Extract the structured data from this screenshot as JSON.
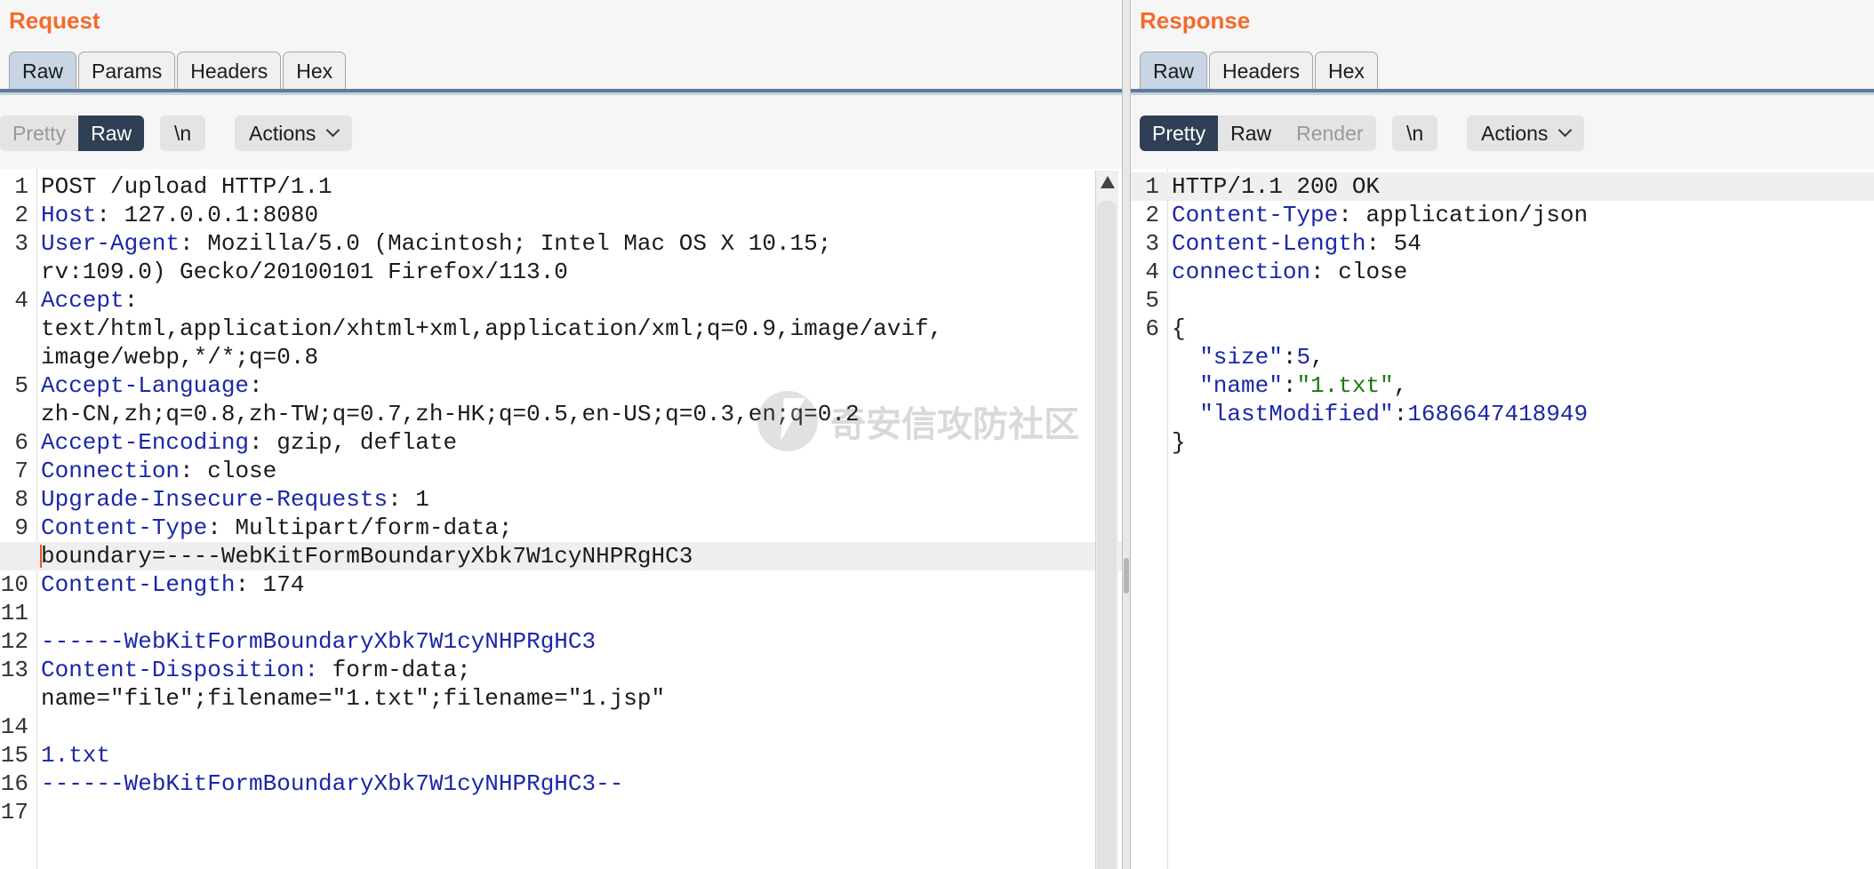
{
  "request": {
    "title": "Request",
    "tabs": [
      "Raw",
      "Params",
      "Headers",
      "Hex"
    ],
    "toolbar": {
      "pretty": "Pretty",
      "raw": "Raw",
      "newline": "\\n",
      "actions": "Actions"
    },
    "lines": [
      {
        "n": "1",
        "parts": [
          {
            "t": "POST /upload HTTP/1.1",
            "c": "plain"
          }
        ]
      },
      {
        "n": "2",
        "parts": [
          {
            "t": "Host",
            "c": "hdr"
          },
          {
            "t": ": 127.0.0.1:8080",
            "c": "plain"
          }
        ]
      },
      {
        "n": "3",
        "parts": [
          {
            "t": "User-Agent",
            "c": "hdr"
          },
          {
            "t": ": Mozilla/5.0 (Macintosh; Intel Mac OS X 10.15;",
            "c": "plain"
          }
        ]
      },
      {
        "n": "",
        "parts": [
          {
            "t": "rv:109.0) Gecko/20100101 Firefox/113.0",
            "c": "plain"
          }
        ]
      },
      {
        "n": "4",
        "parts": [
          {
            "t": "Accept",
            "c": "hdr"
          },
          {
            "t": ":",
            "c": "plain"
          }
        ]
      },
      {
        "n": "",
        "parts": [
          {
            "t": "text/html,application/xhtml+xml,application/xml;q=0.9,image/avif,",
            "c": "plain"
          }
        ]
      },
      {
        "n": "",
        "parts": [
          {
            "t": "image/webp,*/*;q=0.8",
            "c": "plain"
          }
        ]
      },
      {
        "n": "5",
        "parts": [
          {
            "t": "Accept-Language",
            "c": "hdr"
          },
          {
            "t": ":",
            "c": "plain"
          }
        ]
      },
      {
        "n": "",
        "parts": [
          {
            "t": "zh-CN,zh;q=0.8,zh-TW;q=0.7,zh-HK;q=0.5,en-US;q=0.3,en;q=0.2",
            "c": "plain"
          }
        ]
      },
      {
        "n": "6",
        "parts": [
          {
            "t": "Accept-Encoding",
            "c": "hdr"
          },
          {
            "t": ": gzip, deflate",
            "c": "plain"
          }
        ]
      },
      {
        "n": "7",
        "parts": [
          {
            "t": "Connection",
            "c": "hdr"
          },
          {
            "t": ": close",
            "c": "plain"
          }
        ]
      },
      {
        "n": "8",
        "parts": [
          {
            "t": "Upgrade-Insecure-Requests",
            "c": "hdr"
          },
          {
            "t": ": 1",
            "c": "plain"
          }
        ]
      },
      {
        "n": "9",
        "parts": [
          {
            "t": "Content-Type",
            "c": "hdr"
          },
          {
            "t": ": Multipart/form-data;",
            "c": "plain"
          }
        ]
      },
      {
        "n": "",
        "hl": true,
        "caret": true,
        "parts": [
          {
            "t": "boundary=----WebKitFormBoundaryXbk7W1cyNHPRgHC3",
            "c": "plain"
          }
        ]
      },
      {
        "n": "10",
        "parts": [
          {
            "t": "Content-Length",
            "c": "hdr"
          },
          {
            "t": ": 174",
            "c": "plain"
          }
        ]
      },
      {
        "n": "11",
        "parts": []
      },
      {
        "n": "12",
        "parts": [
          {
            "t": "------WebKitFormBoundaryXbk7W1cyNHPRgHC3",
            "c": "blue"
          }
        ]
      },
      {
        "n": "13",
        "parts": [
          {
            "t": "Content-Disposition:",
            "c": "blue"
          },
          {
            "t": " form-data;",
            "c": "plain"
          }
        ]
      },
      {
        "n": "",
        "parts": [
          {
            "t": "name=\"file\";filename=\"1.txt\";filename=\"1.jsp\"",
            "c": "plain"
          }
        ]
      },
      {
        "n": "14",
        "parts": []
      },
      {
        "n": "15",
        "parts": [
          {
            "t": "1.txt",
            "c": "blue"
          }
        ]
      },
      {
        "n": "16",
        "parts": [
          {
            "t": "------WebKitFormBoundaryXbk7W1cyNHPRgHC3--",
            "c": "blue"
          }
        ]
      },
      {
        "n": "17",
        "parts": []
      }
    ]
  },
  "response": {
    "title": "Response",
    "tabs": [
      "Raw",
      "Headers",
      "Hex"
    ],
    "toolbar": {
      "pretty": "Pretty",
      "raw": "Raw",
      "render": "Render",
      "newline": "\\n",
      "actions": "Actions"
    },
    "lines": [
      {
        "n": "1",
        "hl": true,
        "parts": [
          {
            "t": "HTTP/1.1 200 OK",
            "c": "plain"
          }
        ]
      },
      {
        "n": "2",
        "parts": [
          {
            "t": "Content-Type",
            "c": "hdr"
          },
          {
            "t": ": application/json",
            "c": "plain"
          }
        ]
      },
      {
        "n": "3",
        "parts": [
          {
            "t": "Content-Length",
            "c": "hdr"
          },
          {
            "t": ": 54",
            "c": "plain"
          }
        ]
      },
      {
        "n": "4",
        "parts": [
          {
            "t": "connection",
            "c": "hdr"
          },
          {
            "t": ": close",
            "c": "plain"
          }
        ]
      },
      {
        "n": "5",
        "parts": []
      },
      {
        "n": "6",
        "parts": [
          {
            "t": "{",
            "c": "plain"
          }
        ]
      },
      {
        "n": "",
        "parts": [
          {
            "t": "  \"size\"",
            "c": "hdr"
          },
          {
            "t": ":",
            "c": "plain"
          },
          {
            "t": "5",
            "c": "num"
          },
          {
            "t": ",",
            "c": "plain"
          }
        ]
      },
      {
        "n": "",
        "parts": [
          {
            "t": "  \"name\"",
            "c": "hdr"
          },
          {
            "t": ":",
            "c": "plain"
          },
          {
            "t": "\"1.txt\"",
            "c": "str"
          },
          {
            "t": ",",
            "c": "plain"
          }
        ]
      },
      {
        "n": "",
        "parts": [
          {
            "t": "  \"lastModified\"",
            "c": "hdr"
          },
          {
            "t": ":",
            "c": "plain"
          },
          {
            "t": "1686647418949",
            "c": "num"
          }
        ]
      },
      {
        "n": "",
        "parts": [
          {
            "t": "}",
            "c": "plain"
          }
        ]
      }
    ]
  },
  "watermark": {
    "text": "奇安信攻防社区",
    "icon": "bolt-logo-icon"
  },
  "colors": {
    "title_orange": "#f26b2c",
    "active_tab": "#c7d5e4",
    "selected_toggle": "#2f3f55",
    "header_name": "#1a27a8",
    "string_green": "#197a0c"
  }
}
